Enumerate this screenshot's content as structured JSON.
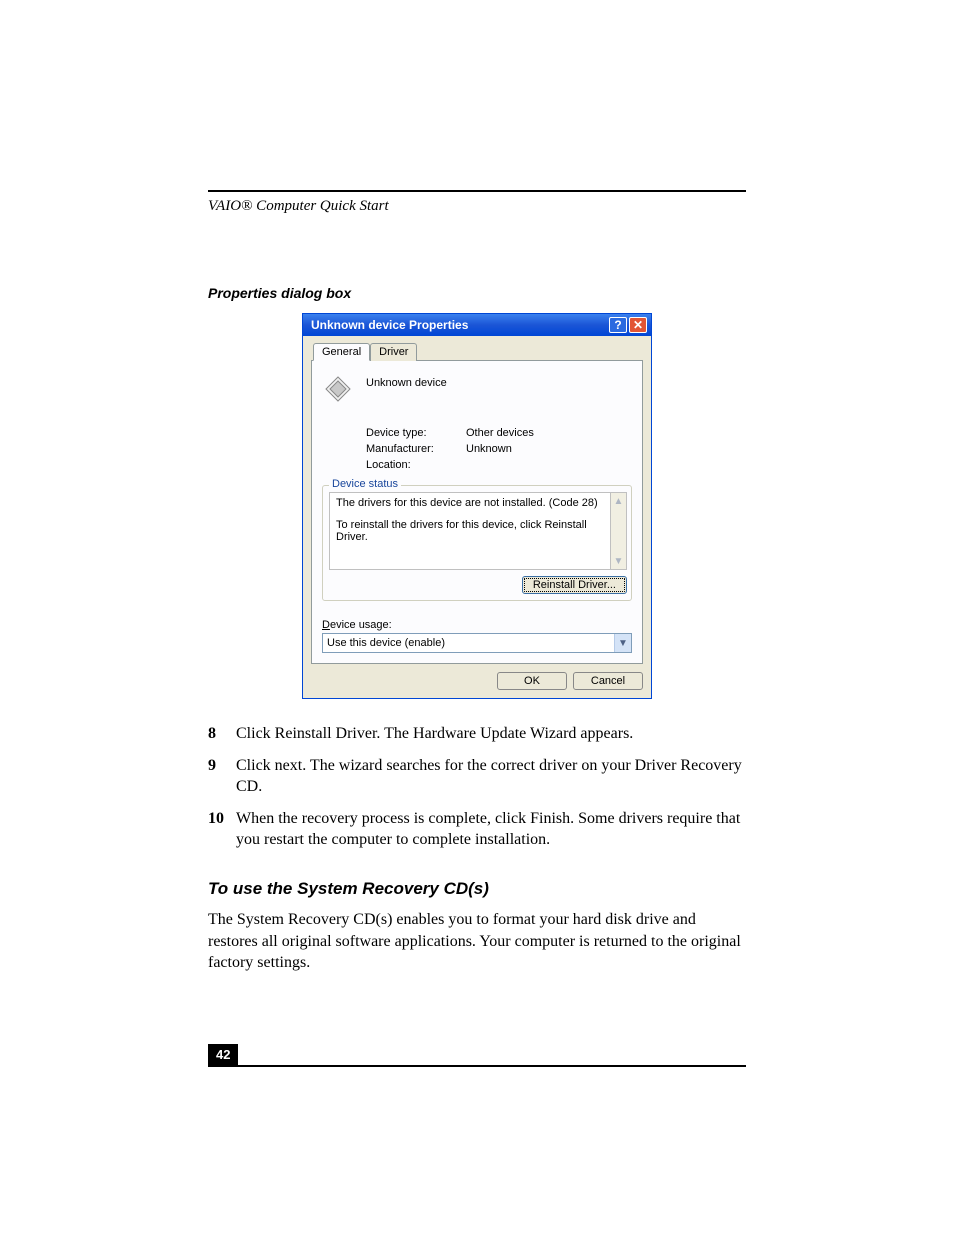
{
  "running_header": "VAIO® Computer Quick Start",
  "caption": "Properties dialog box",
  "dialog": {
    "title": "Unknown device Properties",
    "tabs": {
      "general": "General",
      "driver": "Driver"
    },
    "device_name": "Unknown device",
    "rows": {
      "type_label": "Device type:",
      "type_value": "Other devices",
      "mfr_label": "Manufacturer:",
      "mfr_value": "Unknown",
      "loc_label": "Location:",
      "loc_value": ""
    },
    "status_legend": "Device status",
    "status_line1": "The drivers for this device are not installed. (Code 28)",
    "status_line2": "To reinstall the drivers for this device, click Reinstall Driver.",
    "reinstall_label": "Reinstall Driver...",
    "usage_label_pre": "D",
    "usage_label_rest": "evice usage:",
    "usage_value": "Use this device (enable)",
    "ok_label": "OK",
    "cancel_label": "Cancel"
  },
  "steps": [
    {
      "num": "8",
      "text": "Click Reinstall Driver. The Hardware Update Wizard appears."
    },
    {
      "num": "9",
      "text": "Click next. The wizard searches for the correct driver on your Driver Recovery CD."
    },
    {
      "num": "10",
      "text": "When the recovery process is complete, click Finish. Some drivers require that you restart the computer to complete installation."
    }
  ],
  "subheading": "To use the System Recovery CD(s)",
  "body_para": "The System Recovery CD(s) enables you to format your hard disk drive and restores all original software applications. Your computer is returned to the original factory settings.",
  "page_number": "42"
}
